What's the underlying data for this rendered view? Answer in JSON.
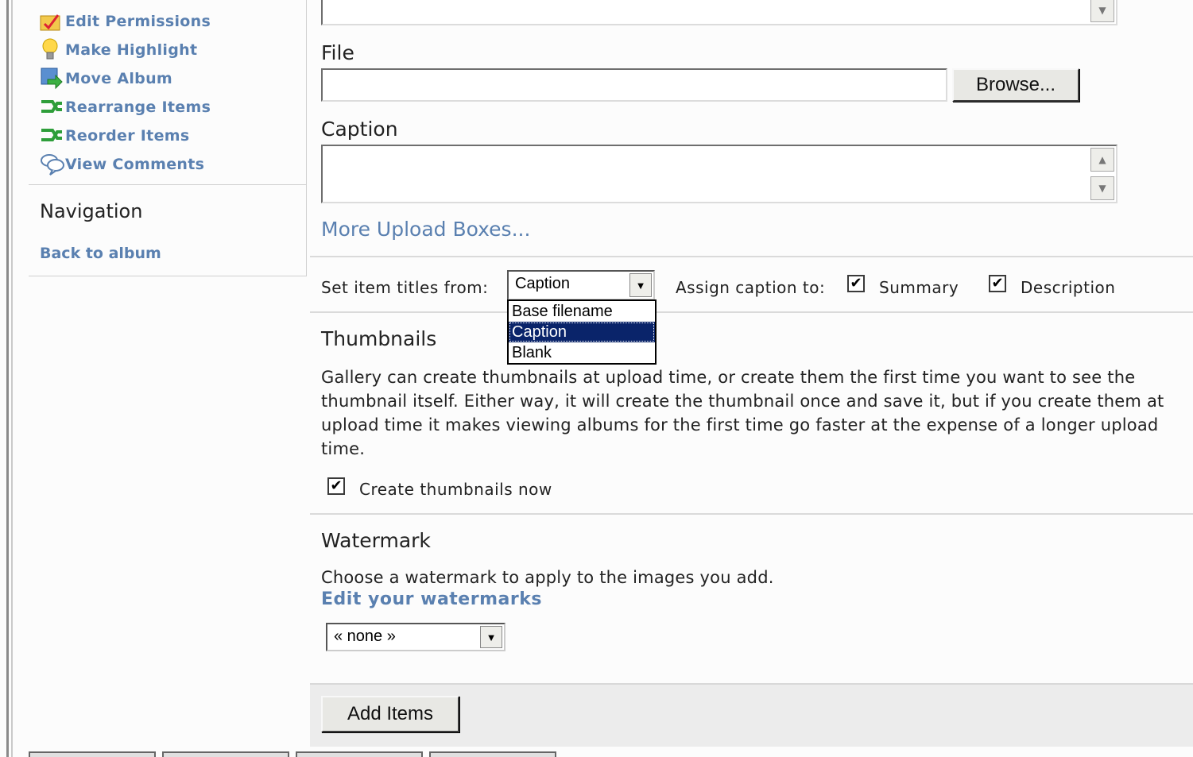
{
  "sidebar": {
    "actions": [
      {
        "label": "Edit Permissions",
        "icon": "permissions-icon"
      },
      {
        "label": "Make Highlight",
        "icon": "lightbulb-icon"
      },
      {
        "label": "Move Album",
        "icon": "move-album-icon"
      },
      {
        "label": "Rearrange Items",
        "icon": "rearrange-icon"
      },
      {
        "label": "Reorder Items",
        "icon": "reorder-icon"
      },
      {
        "label": "View Comments",
        "icon": "comments-icon"
      }
    ],
    "navigation_title": "Navigation",
    "back_link": "Back to album"
  },
  "upload": {
    "file_label": "File",
    "file_value": "",
    "browse_label": "Browse...",
    "caption_label": "Caption",
    "caption_value": "",
    "more_boxes_link": "More Upload Boxes..."
  },
  "options": {
    "titles_label": "Set item titles from:",
    "titles_selected": "Caption",
    "titles_options": [
      "Base filename",
      "Caption",
      "Blank"
    ],
    "assign_caption_label": "Assign caption to:",
    "summary_label": "Summary",
    "summary_checked": true,
    "description_label": "Description",
    "description_checked": true
  },
  "thumbnails": {
    "title": "Thumbnails",
    "description": "Gallery can create thumbnails at upload time, or create them the first time you want to see the thumbnail itself. Either way, it will create the thumbnail once and save it, but if you create them at upload time it makes viewing albums for the first time go faster at the expense of a longer upload time.",
    "create_now_label": "Create thumbnails now",
    "create_now_checked": true
  },
  "watermark": {
    "title": "Watermark",
    "description": "Choose a watermark to apply to the images you add.",
    "edit_link": "Edit your watermarks",
    "selected": "« none »"
  },
  "submit": {
    "add_items_label": "Add Items"
  },
  "colors": {
    "link": "#5a80b0",
    "selection": "#0a246a"
  }
}
